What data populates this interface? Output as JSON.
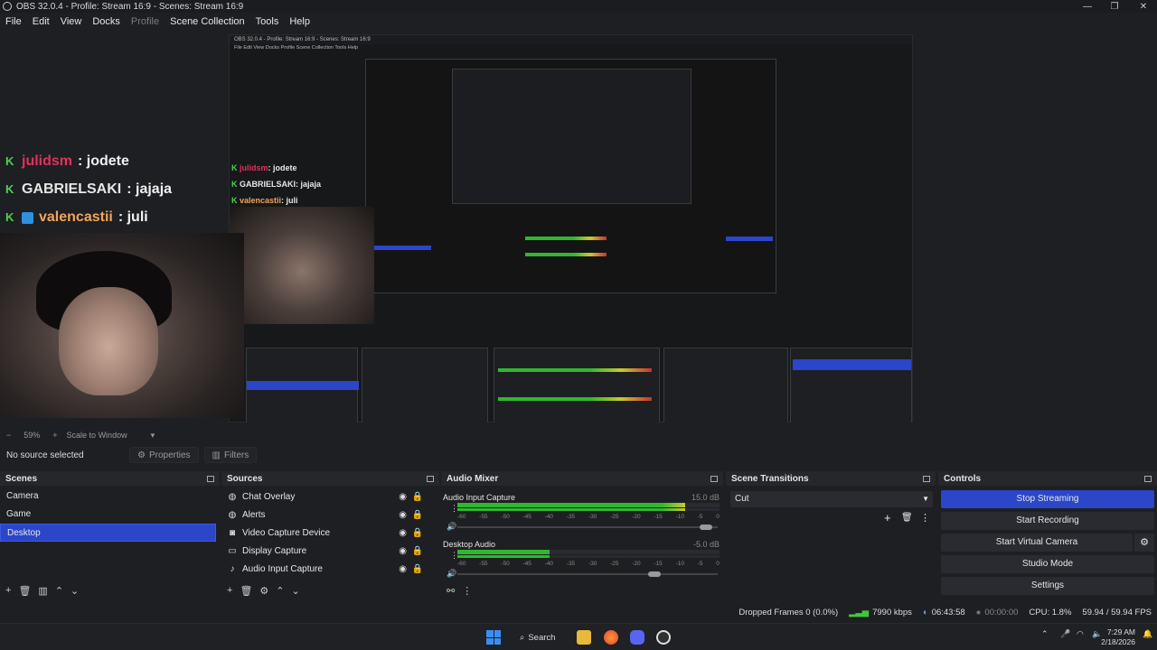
{
  "window": {
    "title": "OBS 32.0.4 - Profile: Stream 16:9 - Scenes: Stream 16:9",
    "minimize": "—",
    "maximize": "❐",
    "close": "✕"
  },
  "menu": [
    "File",
    "Edit",
    "View",
    "Docks",
    "Profile",
    "Scene Collection",
    "Tools",
    "Help"
  ],
  "preview": {
    "chat": [
      {
        "user": "julidsm",
        "message": ": jodete"
      },
      {
        "user": "GABRIELSAKI",
        "message": ": jajaja"
      },
      {
        "user": "valencastii",
        "message": ": juli"
      }
    ],
    "nested_title": "OBS 32.0.4 - Profile: Stream 16:9 - Scenes: Stream 16:9",
    "nested_menu": "File  Edit  View  Docks  Profile  Scene Collection  Tools  Help"
  },
  "zoom": {
    "minus": "−",
    "value": "59%",
    "plus": "+",
    "mode": "Scale to Window"
  },
  "sourcebar": {
    "status": "No source selected",
    "properties": "Properties",
    "filters": "Filters"
  },
  "scenes": {
    "title": "Scenes",
    "items": [
      "Camera",
      "Game",
      "Desktop"
    ],
    "selected_index": 2
  },
  "sources": {
    "title": "Sources",
    "items": [
      {
        "name": "Chat Overlay",
        "icon": "globe-icon"
      },
      {
        "name": "Alerts",
        "icon": "globe-icon"
      },
      {
        "name": "Video Capture Device",
        "icon": "camera-icon"
      },
      {
        "name": "Display Capture",
        "icon": "monitor-icon"
      },
      {
        "name": "Audio Input Capture",
        "icon": "microphone-icon"
      }
    ]
  },
  "audio_mixer": {
    "title": "Audio Mixer",
    "channels": [
      {
        "name": "Audio Input Capture",
        "db": "15.0 dB",
        "level": 0.87,
        "volume": 0.98
      },
      {
        "name": "Desktop Audio",
        "db": "-5.0 dB",
        "level": 0.35,
        "volume": 0.78
      }
    ],
    "scale": [
      "-60",
      "-55",
      "-50",
      "-45",
      "-40",
      "-35",
      "-30",
      "-25",
      "-20",
      "-15",
      "-10",
      "-5",
      "0"
    ]
  },
  "transitions": {
    "title": "Scene Transitions",
    "selected": "Cut"
  },
  "controls": {
    "title": "Controls",
    "buttons": [
      "Stop Streaming",
      "Start Recording",
      "Start Virtual Camera",
      "Studio Mode",
      "Settings"
    ]
  },
  "status": {
    "dropped": "Dropped Frames 0 (0.0%)",
    "bitrate": "7990 kbps",
    "stream_time": "06:43:58",
    "rec_time": "00:00:00",
    "cpu": "CPU: 1.8%",
    "fps": "59.94 / 59.94 FPS"
  },
  "taskbar": {
    "search": "Search",
    "time": "7:29 AM",
    "date": "2/18/2026"
  },
  "colors": {
    "accent": "#2b46c9",
    "meter_green": "#2fb82f",
    "meter_yellow": "#c8c832",
    "meter_red": "#c83232"
  }
}
